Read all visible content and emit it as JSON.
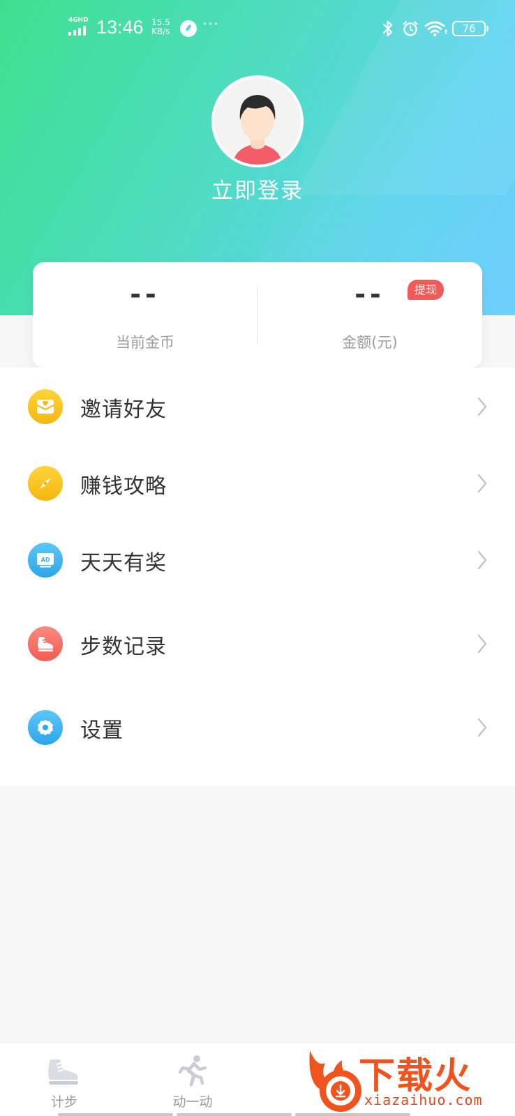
{
  "status_bar": {
    "network": "4GHD",
    "time": "13:46",
    "speed_value": "15.5",
    "speed_unit": "KB/s",
    "more": "···",
    "battery": "76"
  },
  "profile": {
    "login_label": "立即登录"
  },
  "stats": {
    "coins_value": "--",
    "coins_label": "当前金币",
    "amount_value": "--",
    "amount_label": "金额(元)",
    "withdraw_badge": "提现"
  },
  "menu": {
    "items": [
      {
        "label": "邀请好友",
        "icon": "envelope-heart-icon",
        "color": "#f7c21a"
      },
      {
        "label": "赚钱攻略",
        "icon": "compass-icon",
        "color": "#f7c21a"
      },
      {
        "label": "天天有奖",
        "icon": "ad-icon",
        "color": "#3fb3ef"
      },
      {
        "label": "步数记录",
        "icon": "sneaker-icon",
        "color": "#f46a63"
      },
      {
        "label": "设置",
        "icon": "gear-icon",
        "color": "#3fb3ef"
      }
    ]
  },
  "bottom_nav": {
    "tabs": [
      {
        "label": "计步",
        "icon": "sneaker-icon"
      },
      {
        "label": "动一动",
        "icon": "running-icon"
      }
    ]
  },
  "watermark": {
    "brand": "下载火",
    "url": "xiazaihuo.com"
  },
  "colors": {
    "header_gradient_start": "#3ee08e",
    "header_gradient_end": "#5dc9fb",
    "badge_red": "#f25a5a",
    "text_primary": "#333333",
    "text_secondary": "#9b9b9b"
  }
}
